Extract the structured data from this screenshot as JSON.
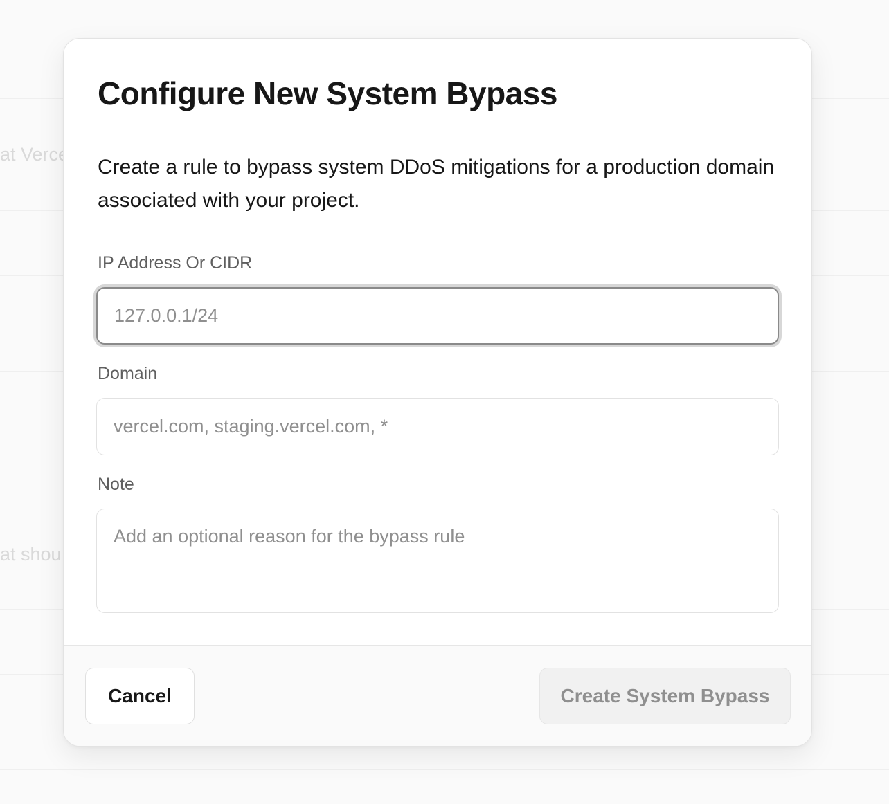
{
  "background": {
    "partial_texts": [
      "at Verce",
      "at shou"
    ]
  },
  "dialog": {
    "title": "Configure New System Bypass",
    "description": "Create a rule to bypass system DDoS mitigations for a production domain associated with your project.",
    "fields": {
      "ip": {
        "label": "IP Address Or CIDR",
        "placeholder": "127.0.0.1/24",
        "value": ""
      },
      "domain": {
        "label": "Domain",
        "placeholder": "vercel.com, staging.vercel.com, *",
        "value": ""
      },
      "note": {
        "label": "Note",
        "placeholder": "Add an optional reason for the bypass rule",
        "value": ""
      }
    },
    "footer": {
      "cancel_label": "Cancel",
      "submit_label": "Create System Bypass"
    }
  },
  "colors": {
    "text_primary": "#171717",
    "text_secondary": "#5f5f5f",
    "placeholder": "#8f8f8f",
    "border": "#e2e2e2",
    "focus_ring": "#d7d7d7",
    "disabled_button_bg": "#f1f1f1"
  }
}
